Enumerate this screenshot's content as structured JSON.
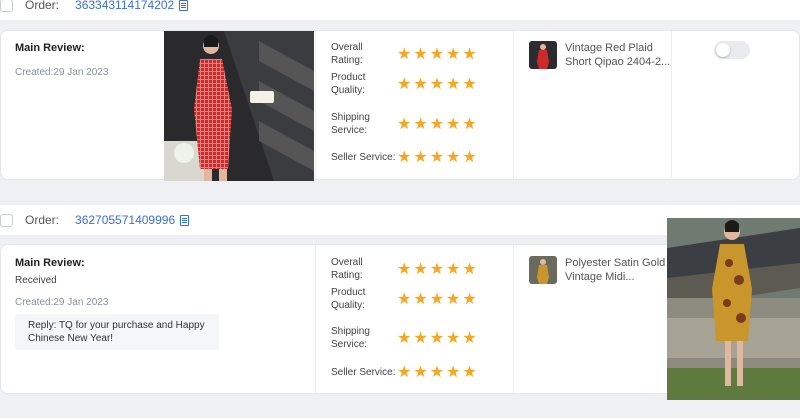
{
  "orders": [
    {
      "order_label": "Order:",
      "order_number": "363343114174202",
      "main_review_title": "Main Review:",
      "created": "Created:29 Jan 2023",
      "ratings": [
        {
          "label": "Overall Rating:",
          "stars": 5
        },
        {
          "label": "Product Quality:",
          "stars": 5
        },
        {
          "label": "Shipping Service:",
          "stars": 5
        },
        {
          "label": "Seller Service:",
          "stars": 5
        }
      ],
      "product_name_line1": "Vintage Red Plaid",
      "product_name_line2": "Short Qipao 2404-2...",
      "toggle_on": false
    },
    {
      "order_label": "Order:",
      "order_number": "362705571409996",
      "main_review_title": "Main Review:",
      "review_text": "Received",
      "created": "Created:29 Jan 2023",
      "reply": "Reply: TQ for your purchase and Happy Chinese New Year!",
      "ratings": [
        {
          "label": "Overall Rating:",
          "stars": 5
        },
        {
          "label": "Product Quality:",
          "stars": 5
        },
        {
          "label": "Shipping Service:",
          "stars": 5
        },
        {
          "label": "Seller Service:",
          "stars": 5
        }
      ],
      "product_name_line1": "Polyester Satin Gold",
      "product_name_line2": "Vintage Midi..."
    }
  ],
  "colors": {
    "accent": "#3a6fd8",
    "star": "#f5a623"
  },
  "star_glyph": "★"
}
